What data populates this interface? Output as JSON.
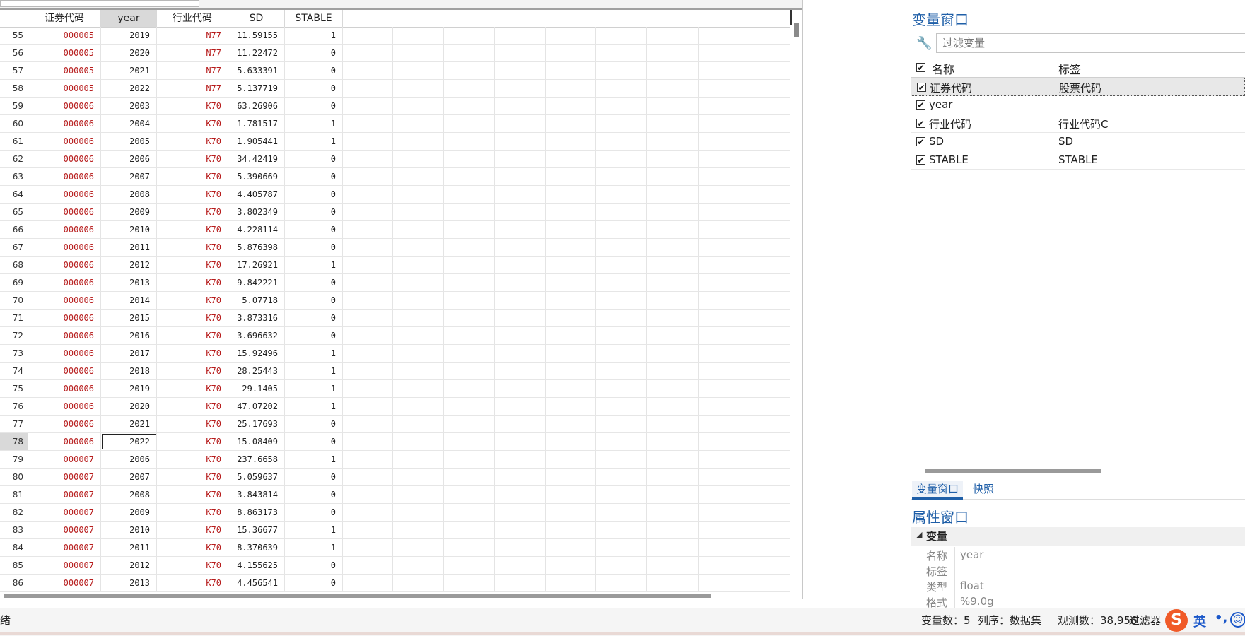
{
  "grid": {
    "headers": [
      "证券代码",
      "year",
      "行业代码",
      "SD",
      "STABLE"
    ],
    "selected_header": "year",
    "current_row": "78",
    "rows": [
      [
        "55",
        "000005",
        "2019",
        "N77",
        "11.59155",
        "1"
      ],
      [
        "56",
        "000005",
        "2020",
        "N77",
        "11.22472",
        "0"
      ],
      [
        "57",
        "000005",
        "2021",
        "N77",
        "5.633391",
        "0"
      ],
      [
        "58",
        "000005",
        "2022",
        "N77",
        "5.137719",
        "0"
      ],
      [
        "59",
        "000006",
        "2003",
        "K70",
        "63.26906",
        "0"
      ],
      [
        "60",
        "000006",
        "2004",
        "K70",
        "1.781517",
        "1"
      ],
      [
        "61",
        "000006",
        "2005",
        "K70",
        "1.905441",
        "1"
      ],
      [
        "62",
        "000006",
        "2006",
        "K70",
        "34.42419",
        "0"
      ],
      [
        "63",
        "000006",
        "2007",
        "K70",
        "5.390669",
        "0"
      ],
      [
        "64",
        "000006",
        "2008",
        "K70",
        "4.405787",
        "0"
      ],
      [
        "65",
        "000006",
        "2009",
        "K70",
        "3.802349",
        "0"
      ],
      [
        "66",
        "000006",
        "2010",
        "K70",
        "4.228114",
        "0"
      ],
      [
        "67",
        "000006",
        "2011",
        "K70",
        "5.876398",
        "0"
      ],
      [
        "68",
        "000006",
        "2012",
        "K70",
        "17.26921",
        "1"
      ],
      [
        "69",
        "000006",
        "2013",
        "K70",
        "9.842221",
        "0"
      ],
      [
        "70",
        "000006",
        "2014",
        "K70",
        "5.07718",
        "0"
      ],
      [
        "71",
        "000006",
        "2015",
        "K70",
        "3.873316",
        "0"
      ],
      [
        "72",
        "000006",
        "2016",
        "K70",
        "3.696632",
        "0"
      ],
      [
        "73",
        "000006",
        "2017",
        "K70",
        "15.92496",
        "1"
      ],
      [
        "74",
        "000006",
        "2018",
        "K70",
        "28.25443",
        "1"
      ],
      [
        "75",
        "000006",
        "2019",
        "K70",
        "29.1405",
        "1"
      ],
      [
        "76",
        "000006",
        "2020",
        "K70",
        "47.07202",
        "1"
      ],
      [
        "77",
        "000006",
        "2021",
        "K70",
        "25.17693",
        "0"
      ],
      [
        "78",
        "000006",
        "2022",
        "K70",
        "15.08409",
        "0"
      ],
      [
        "79",
        "000007",
        "2006",
        "K70",
        "237.6658",
        "1"
      ],
      [
        "80",
        "000007",
        "2007",
        "K70",
        "5.059637",
        "0"
      ],
      [
        "81",
        "000007",
        "2008",
        "K70",
        "3.843814",
        "0"
      ],
      [
        "82",
        "000007",
        "2009",
        "K70",
        "8.863173",
        "0"
      ],
      [
        "83",
        "000007",
        "2010",
        "K70",
        "15.36677",
        "1"
      ],
      [
        "84",
        "000007",
        "2011",
        "K70",
        "8.370639",
        "1"
      ],
      [
        "85",
        "000007",
        "2012",
        "K70",
        "4.155625",
        "0"
      ],
      [
        "86",
        "000007",
        "2013",
        "K70",
        "4.456541",
        "0"
      ]
    ]
  },
  "variables_window": {
    "title": "变量窗口",
    "filter_placeholder": "过滤变量",
    "col_name": "名称",
    "col_label": "标签",
    "variables": [
      {
        "name": "证券代码",
        "label": "股票代码",
        "checked": true
      },
      {
        "name": "year",
        "label": "",
        "checked": true
      },
      {
        "name": "行业代码",
        "label": "行业代码C",
        "checked": true
      },
      {
        "name": "SD",
        "label": "SD",
        "checked": true
      },
      {
        "name": "STABLE",
        "label": "STABLE",
        "checked": true
      }
    ]
  },
  "tabs": [
    "变量窗口",
    "快照"
  ],
  "properties_window": {
    "title": "属性窗口",
    "section": "变量",
    "rows": [
      {
        "key": "名称",
        "value": "year"
      },
      {
        "key": "标签",
        "value": ""
      },
      {
        "key": "类型",
        "value": "float"
      },
      {
        "key": "格式",
        "value": "%9.0g"
      }
    ]
  },
  "status": {
    "left": "绪",
    "vars": "变量数：5",
    "order": "列序：数据集",
    "obs": "观测数：38,956",
    "filter": "过滤器"
  },
  "ime": {
    "logo": "S",
    "lang": "英",
    "punct": "•,",
    "emoji": "☺"
  },
  "colors": {
    "accent": "#1f5fa8",
    "string_value": "#b71c1c"
  },
  "icons": [
    "wrench-icon",
    "checkbox-checked-icon",
    "collapse-triangle-icon"
  ]
}
